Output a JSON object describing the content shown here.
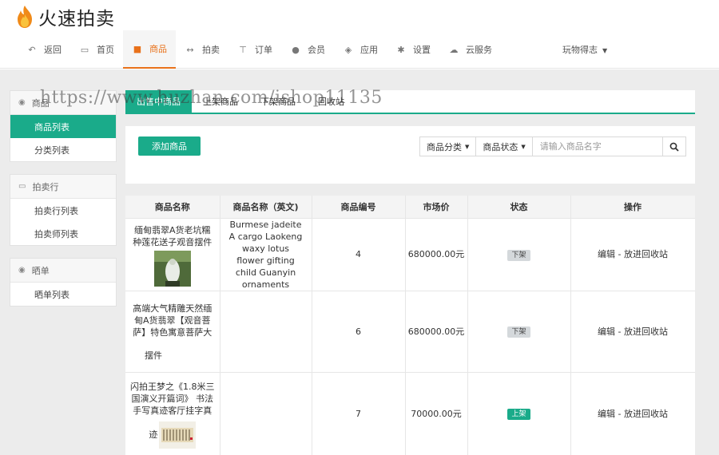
{
  "app": {
    "title": "火速拍卖"
  },
  "nav": [
    {
      "label": "返回",
      "icon": "back-icon"
    },
    {
      "label": "首页",
      "icon": "monitor-icon"
    },
    {
      "label": "商品",
      "icon": "gift-icon",
      "active": true
    },
    {
      "label": "拍卖",
      "icon": "arrows-icon"
    },
    {
      "label": "订单",
      "icon": "cart-icon"
    },
    {
      "label": "会员",
      "icon": "users-icon"
    },
    {
      "label": "应用",
      "icon": "cubes-icon"
    },
    {
      "label": "设置",
      "icon": "gear-icon"
    },
    {
      "label": "云服务",
      "icon": "cloud-icon"
    }
  ],
  "user": {
    "label": "玩物得志"
  },
  "sidebar": {
    "groups": [
      {
        "title": "商品",
        "icon": "globe-icon",
        "items": [
          "商品列表",
          "分类列表"
        ]
      },
      {
        "title": "拍卖行",
        "icon": "inbox-icon",
        "items": [
          "拍卖行列表",
          "拍卖师列表"
        ]
      },
      {
        "title": "晒单",
        "icon": "globe-icon",
        "items": [
          "晒单列表"
        ]
      }
    ]
  },
  "tabs": [
    "出售中商品",
    "上架商品",
    "下架商品",
    "回收站"
  ],
  "watermark": "https://www.huzhan.com/ishop11135",
  "toolbar": {
    "add_label": "添加商品",
    "category_label": "商品分类",
    "status_label": "商品状态",
    "search_placeholder": "请输入商品名字"
  },
  "table": {
    "headers": [
      "商品名称",
      "商品名称（英文)",
      "商品编号",
      "市场价",
      "状态",
      "操作"
    ],
    "rows": [
      {
        "name": "缅甸翡翠A货老坑糯种莲花送子观音摆件",
        "name_en": "Burmese jadeite A cargo Laokeng waxy lotus flower gifting child Guanyin ornaments",
        "id": "4",
        "price": "680000.00元",
        "status": "下架",
        "status_on": false,
        "edit": "编辑",
        "sep": "-",
        "recycle": "放进回收站"
      },
      {
        "name": "高端大气精雕天然缅甸A货翡翠【观音菩萨】特色寓意菩萨大",
        "name_tail": "摆件",
        "name_en": "",
        "id": "6",
        "price": "680000.00元",
        "status": "下架",
        "status_on": false,
        "edit": "编辑",
        "sep": "-",
        "recycle": "放进回收站"
      },
      {
        "name": "闪拍王梦之《1.8米三国演义开篇词》 书法手写真迹客厅挂字真",
        "name_tail": "迹",
        "name_en": "",
        "id": "7",
        "price": "70000.00元",
        "status": "上架",
        "status_on": true,
        "edit": "编辑",
        "sep": "-",
        "recycle": "放进回收站"
      }
    ]
  }
}
